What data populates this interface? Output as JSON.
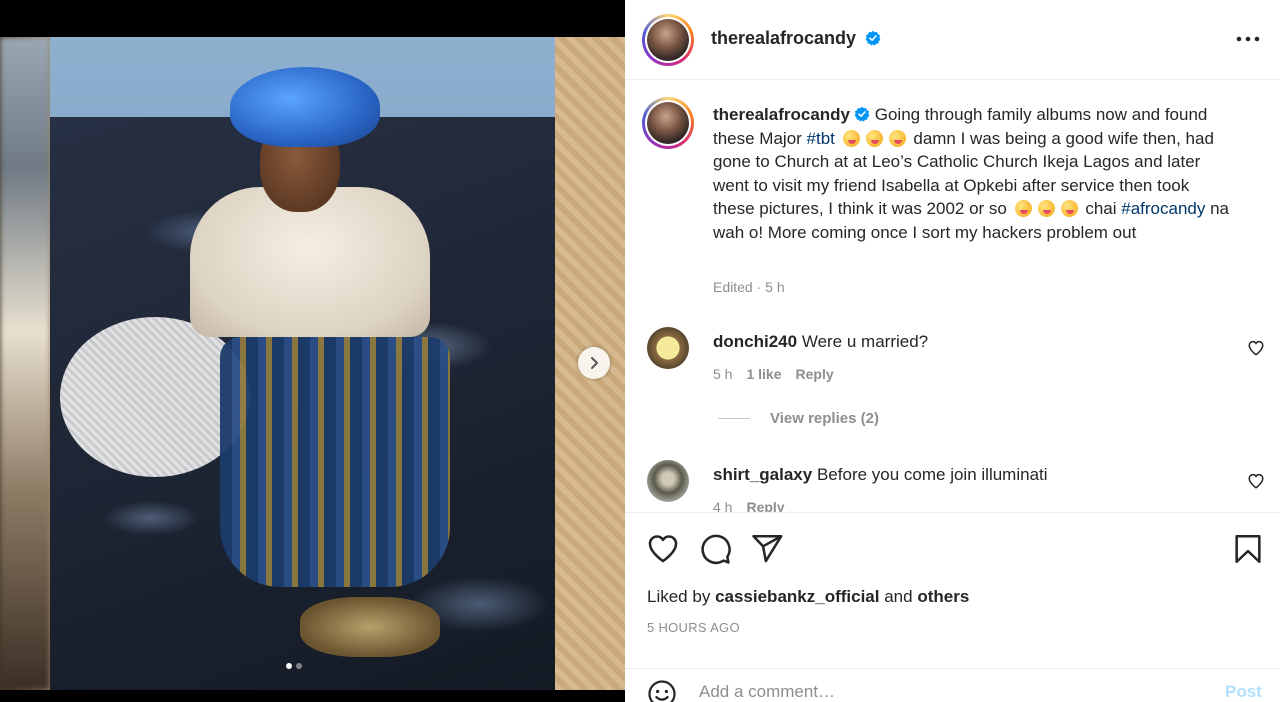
{
  "post": {
    "username": "therealafrocandy",
    "verified": true
  },
  "media": {
    "carousel_index": 1,
    "carousel_total": 2
  },
  "caption": {
    "username": "therealafrocandy",
    "part1": "Going through family albums now and found these Major ",
    "hashtag1": "#tbt",
    "part2": " damn I was being a good wife then, had gone to Church at at Leo’s Catholic Church Ikeja Lagos and later went to visit my friend Isabella at Opkebi after service then took these pictures, I think it was 2002 or so ",
    "part3": " chai ",
    "hashtag2": "#afrocandy",
    "part4": " na wah o! More coming once I sort my hackers problem out",
    "meta": "Edited · 5 h"
  },
  "comments": [
    {
      "username": "donchi240",
      "text": "Were u married?",
      "time": "5 h",
      "likes": "1 like",
      "reply": "Reply"
    },
    {
      "username": "shirt_galaxy",
      "text": "Before you come join illuminati",
      "time": "4 h",
      "reply": "Reply"
    }
  ],
  "view_replies": "View replies (2)",
  "likes": {
    "prefix": "Liked by",
    "user": "cassiebankz_official",
    "middle": "and",
    "others": "others"
  },
  "timestamp": "5 HOURS AGO",
  "add_comment": {
    "placeholder": "Add a comment…",
    "post_label": "Post"
  },
  "icons": {
    "more": "more-horizontal-icon",
    "like": "heart-icon",
    "comment": "comment-bubble-icon",
    "share": "paper-plane-icon",
    "save": "bookmark-icon",
    "emoji": "smiley-icon",
    "next": "chevron-right-icon",
    "verified": "verified-badge-icon"
  },
  "colors": {
    "verified_blue": "#0095f6",
    "hashtag": "#00376b",
    "muted_text": "#8e8e8e",
    "post_disabled": "#b2dffc"
  }
}
